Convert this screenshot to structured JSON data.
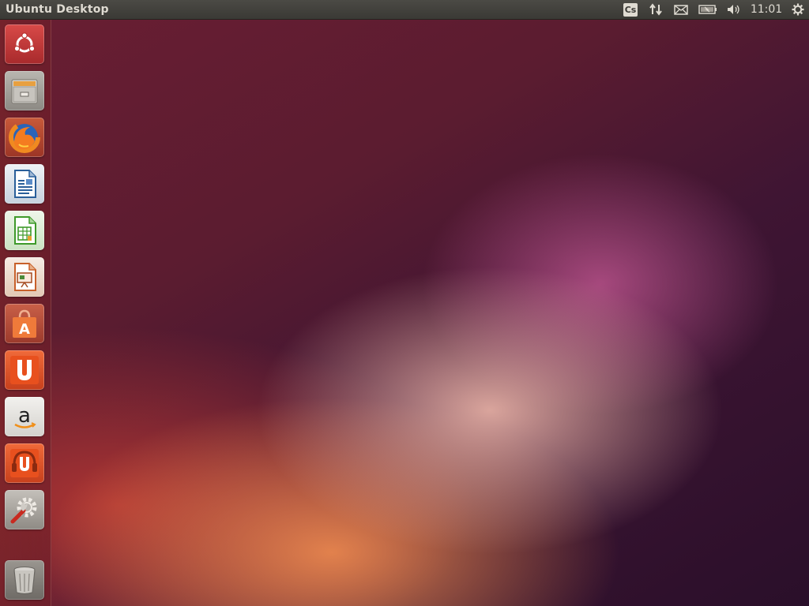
{
  "panel": {
    "title": "Ubuntu Desktop",
    "indicators": {
      "input_method": "Cs",
      "clock": "11:01"
    }
  },
  "icons": {
    "input": "keyboard-input-icon",
    "network": "network-arrows-icon",
    "messages": "mail-envelope-icon",
    "battery": "battery-icon",
    "volume": "speaker-volume-icon",
    "session": "gear-icon"
  },
  "launcher": {
    "items": [
      {
        "name": "dash-home",
        "icon": "ubuntu-logo-icon",
        "color": "#c23a3a"
      },
      {
        "name": "files",
        "icon": "file-cabinet-icon",
        "color": "#9a9893"
      },
      {
        "name": "firefox",
        "icon": "firefox-icon",
        "color": "#b9482f"
      },
      {
        "name": "libreoffice-writer",
        "icon": "writer-document-icon",
        "color": "#2a5f9a"
      },
      {
        "name": "libreoffice-calc",
        "icon": "calc-spreadsheet-icon",
        "color": "#3e9a2a"
      },
      {
        "name": "libreoffice-impress",
        "icon": "impress-presentation-icon",
        "color": "#c8602a"
      },
      {
        "name": "software-center",
        "icon": "shopping-bag-icon",
        "color": "#e8682a"
      },
      {
        "name": "ubuntu-one",
        "icon": "ubuntu-one-icon",
        "color": "#e04a1a"
      },
      {
        "name": "amazon",
        "icon": "amazon-logo-icon",
        "color": "#e8e6e2"
      },
      {
        "name": "ubuntu-one-music",
        "icon": "music-headphones-icon",
        "color": "#e04a1a"
      },
      {
        "name": "system-settings",
        "icon": "wrench-gear-icon",
        "color": "#b0aca6"
      },
      {
        "name": "trash",
        "icon": "trash-icon",
        "color": "#8a8680"
      }
    ]
  }
}
